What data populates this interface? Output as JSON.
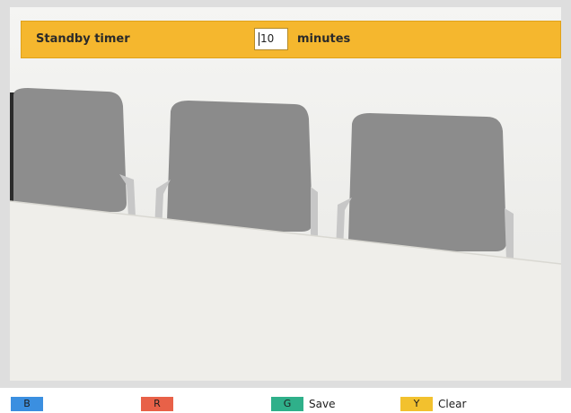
{
  "settings": {
    "label": "Standby timer",
    "value": "10",
    "units": "minutes"
  },
  "footer": {
    "keys": [
      {
        "letter": "B",
        "label": "",
        "color": "#3b8fe0"
      },
      {
        "letter": "R",
        "label": "",
        "color": "#e86148"
      },
      {
        "letter": "G",
        "label": "Save",
        "color": "#2fb08a"
      },
      {
        "letter": "Y",
        "label": "Clear",
        "color": "#f2c12e"
      }
    ]
  },
  "colors": {
    "settings_bar": "#f5b72e",
    "background": "#dedede"
  }
}
